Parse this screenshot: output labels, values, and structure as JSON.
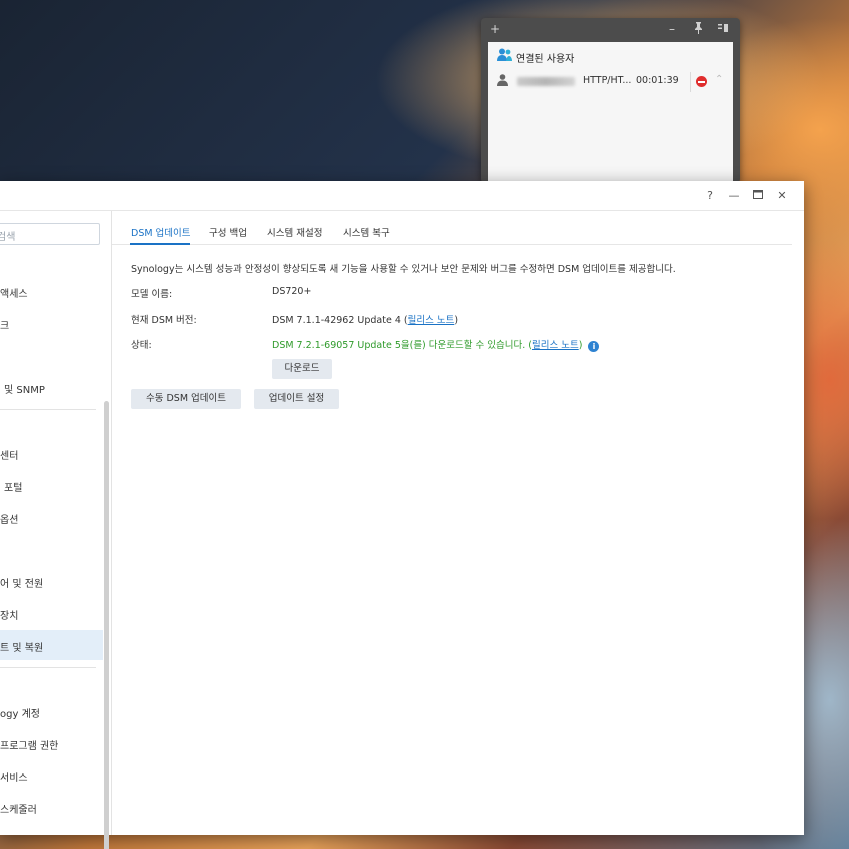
{
  "widget": {
    "buttons": {
      "add": "+",
      "minimize": "–",
      "pin": "📌",
      "settings": "⚙"
    },
    "title": "연결된 사용자",
    "user": {
      "protocol": "HTTP/HT...",
      "time": "00:01:39"
    }
  },
  "window": {
    "controls": {
      "help": "?",
      "minimize": "—",
      "maximize": "□",
      "close": "✕"
    }
  },
  "sidebar": {
    "search_placeholder": "검색",
    "items": [
      {
        "label": "액세스",
        "active": false
      },
      {
        "label": "크",
        "active": false
      },
      {
        "label": "및 SNMP",
        "active": false
      },
      {
        "label": "센터",
        "active": false
      },
      {
        "label": "포털",
        "active": false
      },
      {
        "label": "옵션",
        "active": false
      },
      {
        "label": "어 및 전원",
        "active": false
      },
      {
        "label": "장치",
        "active": false
      },
      {
        "label": "트 및 복원",
        "active": true
      },
      {
        "label": "ogy 계정",
        "active": false
      },
      {
        "label": "프로그램 권한",
        "active": false
      },
      {
        "label": "서비스",
        "active": false
      },
      {
        "label": "스케줄러",
        "active": false
      }
    ]
  },
  "tabs": [
    {
      "label": "DSM 업데이트",
      "active": true
    },
    {
      "label": "구성 백업",
      "active": false
    },
    {
      "label": "시스템 재설정",
      "active": false
    },
    {
      "label": "시스템 복구",
      "active": false
    }
  ],
  "main": {
    "description": "Synology는 시스템 성능과 안정성이 향상되도록 새 기능을 사용할 수 있거나 보안 문제와 버그를 수정하면 DSM 업데이트를 제공합니다.",
    "model_label": "모델 이름:",
    "model_value": "DS720+",
    "version_label": "현재 DSM 버전:",
    "version_value": "DSM 7.1.1-42962 Update 4",
    "release_notes": "릴리스 노트",
    "status_label": "상태:",
    "status_value": "DSM 7.2.1-69057 Update 5을(를) 다운로드할 수 있습니다.",
    "info": "i",
    "download_button": "다운로드",
    "manual_update_button": "수동 DSM 업데이트",
    "update_settings_button": "업데이트 설정"
  },
  "colors": {
    "accent": "#1a72c5",
    "success": "#2e9a2a",
    "danger": "#e02d2d"
  }
}
